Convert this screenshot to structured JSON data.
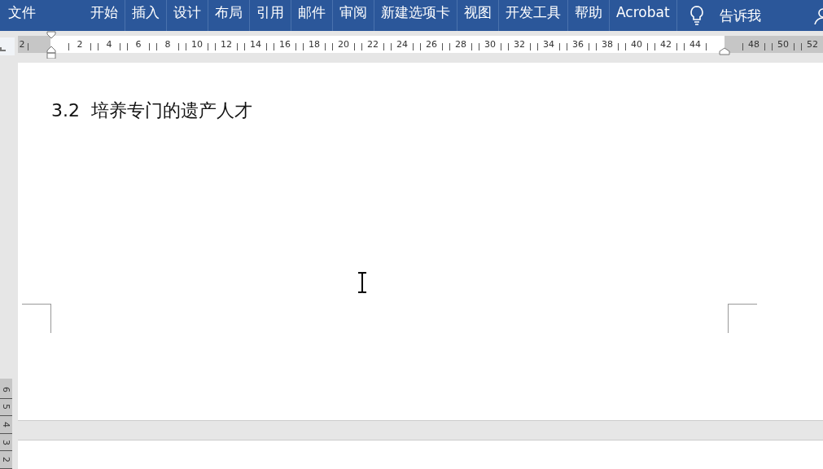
{
  "ribbon": {
    "tabs": [
      {
        "label": "文件",
        "selected": false
      },
      {
        "label": "开始",
        "selected": false
      },
      {
        "label": "插入",
        "selected": false
      },
      {
        "label": "设计",
        "selected": false
      },
      {
        "label": "布局",
        "selected": false
      },
      {
        "label": "引用",
        "selected": false
      },
      {
        "label": "邮件",
        "selected": false
      },
      {
        "label": "审阅",
        "selected": false
      },
      {
        "label": "新建选项卡",
        "selected": false
      },
      {
        "label": "视图",
        "selected": false
      },
      {
        "label": "开发工具",
        "selected": false
      },
      {
        "label": "帮助",
        "selected": false
      },
      {
        "label": "Acrobat",
        "selected": false
      }
    ],
    "tell_me": "告诉我"
  },
  "ruler": {
    "left_margin_labels": [
      "2"
    ],
    "labels": [
      "2",
      "4",
      "6",
      "8",
      "10",
      "12",
      "14",
      "16",
      "18",
      "20",
      "22",
      "24",
      "26",
      "28",
      "30",
      "32",
      "34",
      "36",
      "38",
      "40",
      "42",
      "44"
    ],
    "right_margin_labels": [
      "48",
      "50",
      "52"
    ]
  },
  "vertical_ruler": {
    "labels": [
      "6",
      "5",
      "4",
      "3",
      "2"
    ]
  },
  "document": {
    "heading": "3.2  培养专门的遗产人才"
  }
}
